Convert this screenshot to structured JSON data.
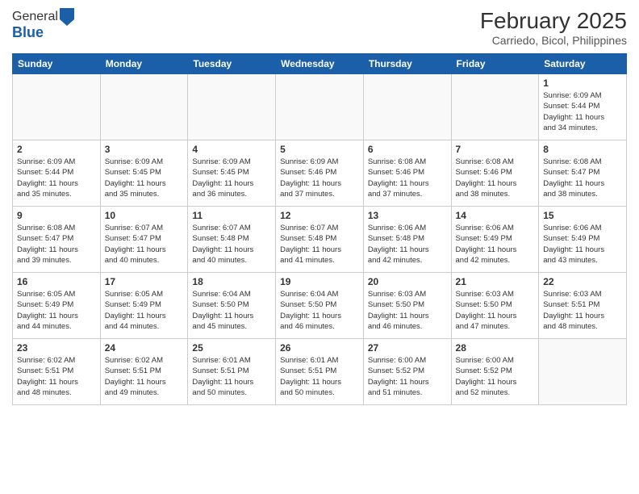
{
  "header": {
    "logo_line1": "General",
    "logo_line2": "Blue",
    "month_year": "February 2025",
    "location": "Carriedo, Bicol, Philippines"
  },
  "days_of_week": [
    "Sunday",
    "Monday",
    "Tuesday",
    "Wednesday",
    "Thursday",
    "Friday",
    "Saturday"
  ],
  "weeks": [
    [
      {
        "day": "",
        "info": ""
      },
      {
        "day": "",
        "info": ""
      },
      {
        "day": "",
        "info": ""
      },
      {
        "day": "",
        "info": ""
      },
      {
        "day": "",
        "info": ""
      },
      {
        "day": "",
        "info": ""
      },
      {
        "day": "1",
        "info": "Sunrise: 6:09 AM\nSunset: 5:44 PM\nDaylight: 11 hours\nand 34 minutes."
      }
    ],
    [
      {
        "day": "2",
        "info": "Sunrise: 6:09 AM\nSunset: 5:44 PM\nDaylight: 11 hours\nand 35 minutes."
      },
      {
        "day": "3",
        "info": "Sunrise: 6:09 AM\nSunset: 5:45 PM\nDaylight: 11 hours\nand 35 minutes."
      },
      {
        "day": "4",
        "info": "Sunrise: 6:09 AM\nSunset: 5:45 PM\nDaylight: 11 hours\nand 36 minutes."
      },
      {
        "day": "5",
        "info": "Sunrise: 6:09 AM\nSunset: 5:46 PM\nDaylight: 11 hours\nand 37 minutes."
      },
      {
        "day": "6",
        "info": "Sunrise: 6:08 AM\nSunset: 5:46 PM\nDaylight: 11 hours\nand 37 minutes."
      },
      {
        "day": "7",
        "info": "Sunrise: 6:08 AM\nSunset: 5:46 PM\nDaylight: 11 hours\nand 38 minutes."
      },
      {
        "day": "8",
        "info": "Sunrise: 6:08 AM\nSunset: 5:47 PM\nDaylight: 11 hours\nand 38 minutes."
      }
    ],
    [
      {
        "day": "9",
        "info": "Sunrise: 6:08 AM\nSunset: 5:47 PM\nDaylight: 11 hours\nand 39 minutes."
      },
      {
        "day": "10",
        "info": "Sunrise: 6:07 AM\nSunset: 5:47 PM\nDaylight: 11 hours\nand 40 minutes."
      },
      {
        "day": "11",
        "info": "Sunrise: 6:07 AM\nSunset: 5:48 PM\nDaylight: 11 hours\nand 40 minutes."
      },
      {
        "day": "12",
        "info": "Sunrise: 6:07 AM\nSunset: 5:48 PM\nDaylight: 11 hours\nand 41 minutes."
      },
      {
        "day": "13",
        "info": "Sunrise: 6:06 AM\nSunset: 5:48 PM\nDaylight: 11 hours\nand 42 minutes."
      },
      {
        "day": "14",
        "info": "Sunrise: 6:06 AM\nSunset: 5:49 PM\nDaylight: 11 hours\nand 42 minutes."
      },
      {
        "day": "15",
        "info": "Sunrise: 6:06 AM\nSunset: 5:49 PM\nDaylight: 11 hours\nand 43 minutes."
      }
    ],
    [
      {
        "day": "16",
        "info": "Sunrise: 6:05 AM\nSunset: 5:49 PM\nDaylight: 11 hours\nand 44 minutes."
      },
      {
        "day": "17",
        "info": "Sunrise: 6:05 AM\nSunset: 5:49 PM\nDaylight: 11 hours\nand 44 minutes."
      },
      {
        "day": "18",
        "info": "Sunrise: 6:04 AM\nSunset: 5:50 PM\nDaylight: 11 hours\nand 45 minutes."
      },
      {
        "day": "19",
        "info": "Sunrise: 6:04 AM\nSunset: 5:50 PM\nDaylight: 11 hours\nand 46 minutes."
      },
      {
        "day": "20",
        "info": "Sunrise: 6:03 AM\nSunset: 5:50 PM\nDaylight: 11 hours\nand 46 minutes."
      },
      {
        "day": "21",
        "info": "Sunrise: 6:03 AM\nSunset: 5:50 PM\nDaylight: 11 hours\nand 47 minutes."
      },
      {
        "day": "22",
        "info": "Sunrise: 6:03 AM\nSunset: 5:51 PM\nDaylight: 11 hours\nand 48 minutes."
      }
    ],
    [
      {
        "day": "23",
        "info": "Sunrise: 6:02 AM\nSunset: 5:51 PM\nDaylight: 11 hours\nand 48 minutes."
      },
      {
        "day": "24",
        "info": "Sunrise: 6:02 AM\nSunset: 5:51 PM\nDaylight: 11 hours\nand 49 minutes."
      },
      {
        "day": "25",
        "info": "Sunrise: 6:01 AM\nSunset: 5:51 PM\nDaylight: 11 hours\nand 50 minutes."
      },
      {
        "day": "26",
        "info": "Sunrise: 6:01 AM\nSunset: 5:51 PM\nDaylight: 11 hours\nand 50 minutes."
      },
      {
        "day": "27",
        "info": "Sunrise: 6:00 AM\nSunset: 5:52 PM\nDaylight: 11 hours\nand 51 minutes."
      },
      {
        "day": "28",
        "info": "Sunrise: 6:00 AM\nSunset: 5:52 PM\nDaylight: 11 hours\nand 52 minutes."
      },
      {
        "day": "",
        "info": ""
      }
    ]
  ]
}
